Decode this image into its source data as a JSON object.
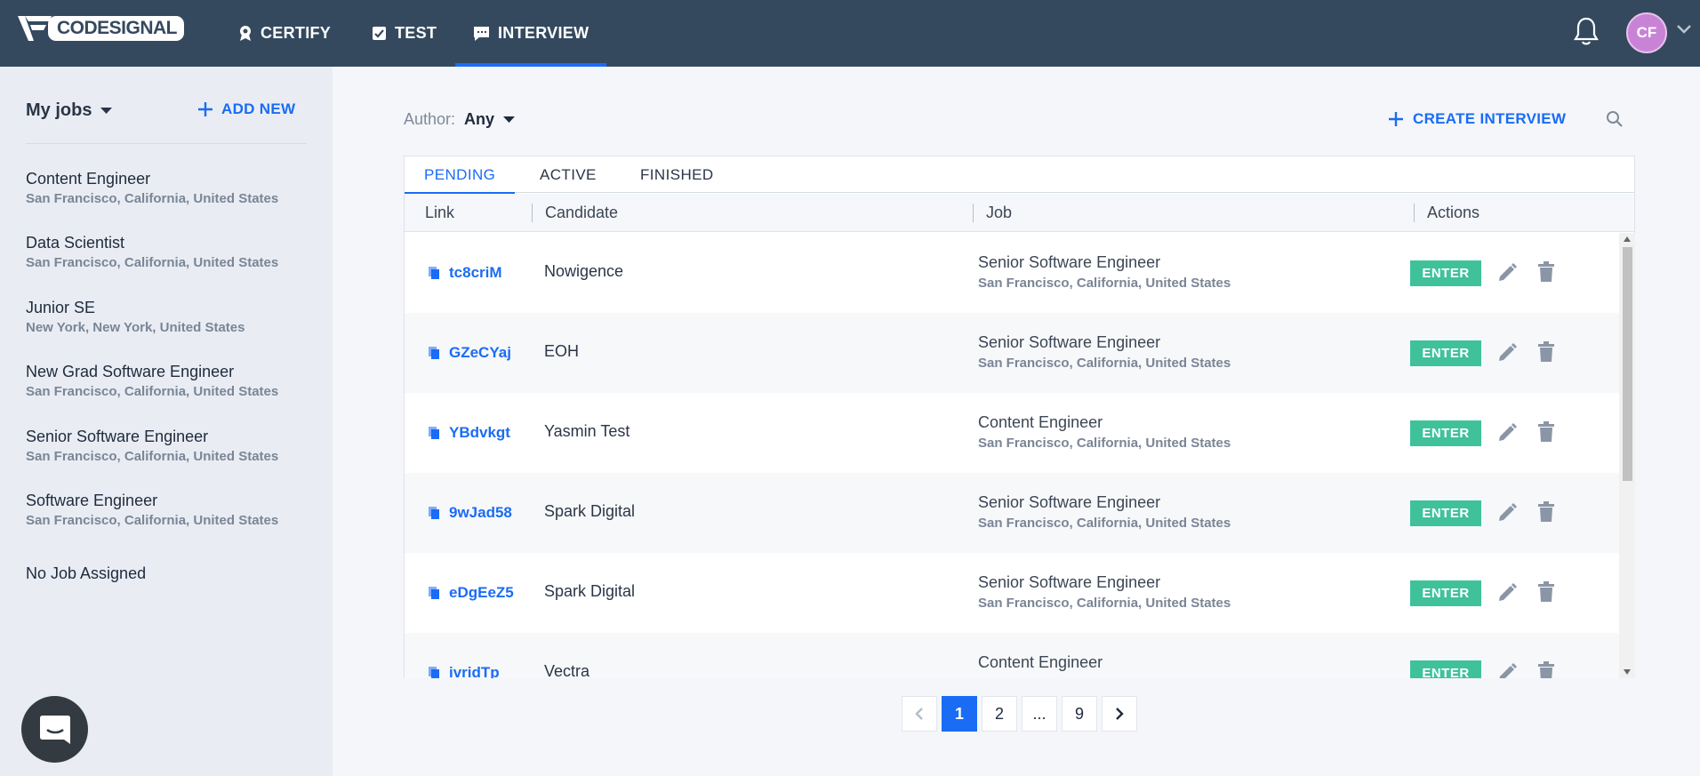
{
  "brand": {
    "name": "CODESIGNAL"
  },
  "nav": {
    "items": [
      {
        "label": "CERTIFY",
        "icon": "ribbon-icon"
      },
      {
        "label": "TEST",
        "icon": "checkbox-icon"
      },
      {
        "label": "INTERVIEW",
        "icon": "chat-icon",
        "active": true
      }
    ],
    "user_initials": "CF"
  },
  "sidebar": {
    "title": "My jobs",
    "add_label": "ADD NEW",
    "jobs": [
      {
        "title": "Content Engineer",
        "location": "San Francisco, California, United States"
      },
      {
        "title": "Data Scientist",
        "location": "San Francisco, California, United States"
      },
      {
        "title": "Junior SE",
        "location": "New York, New York, United States"
      },
      {
        "title": "New Grad Software Engineer",
        "location": "San Francisco, California, United States"
      },
      {
        "title": "Senior Software Engineer",
        "location": "San Francisco, California, United States"
      },
      {
        "title": "Software Engineer",
        "location": "San Francisco, California, United States"
      },
      {
        "title": "No Job Assigned",
        "location": ""
      }
    ]
  },
  "filter": {
    "label": "Author:",
    "value": "Any"
  },
  "create_label": "CREATE INTERVIEW",
  "tabs": [
    {
      "label": "PENDING",
      "active": true
    },
    {
      "label": "ACTIVE"
    },
    {
      "label": "FINISHED"
    }
  ],
  "table": {
    "columns": [
      "Link",
      "Candidate",
      "Job",
      "Actions"
    ],
    "enter_label": "ENTER",
    "rows": [
      {
        "link": "tc8criM",
        "candidate": "Nowigence",
        "job": "Senior Software Engineer",
        "location": "San Francisco, California, United States"
      },
      {
        "link": "GZeCYaj",
        "candidate": "EOH",
        "job": "Senior Software Engineer",
        "location": "San Francisco, California, United States"
      },
      {
        "link": "YBdvkgt",
        "candidate": "Yasmin Test",
        "job": "Content Engineer",
        "location": "San Francisco, California, United States"
      },
      {
        "link": "9wJad58",
        "candidate": "Spark Digital",
        "job": "Senior Software Engineer",
        "location": "San Francisco, California, United States"
      },
      {
        "link": "eDgEeZ5",
        "candidate": "Spark Digital",
        "job": "Senior Software Engineer",
        "location": "San Francisco, California, United States"
      },
      {
        "link": "ivridTp",
        "candidate": "Vectra",
        "job": "Content Engineer",
        "location": ""
      }
    ]
  },
  "pagination": {
    "pages": [
      "1",
      "2",
      "...",
      "9"
    ],
    "current": "1"
  },
  "colors": {
    "nav_bg": "#34495e",
    "accent": "#1a6cf5",
    "enter": "#3fc29a",
    "sidebar_bg": "#e9edf3"
  }
}
